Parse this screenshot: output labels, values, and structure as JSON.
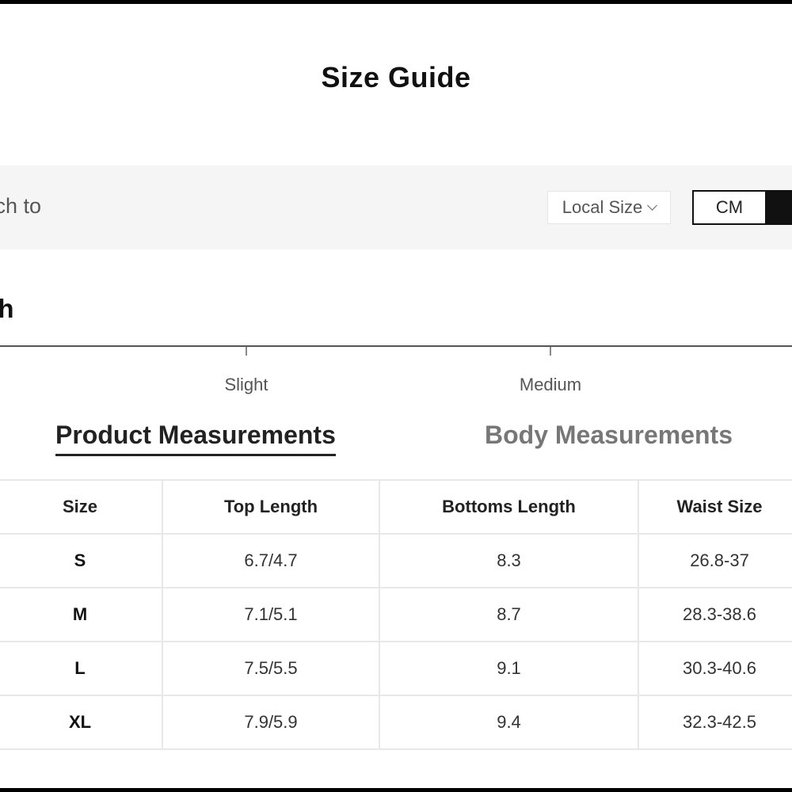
{
  "title": "Size Guide",
  "switch_bar": {
    "label": "tch to",
    "local_size": "Local Size",
    "unit_selected": "CM"
  },
  "stretch": {
    "heading": "tch",
    "levels": [
      "Slight",
      "Medium"
    ]
  },
  "tabs": [
    {
      "label": "Product Measurements",
      "active": true
    },
    {
      "label": "Body Measurements",
      "active": false
    }
  ],
  "table": {
    "headers": [
      "Size",
      "Top Length",
      "Bottoms Length",
      "Waist Size"
    ],
    "rows": [
      [
        "S",
        "6.7/4.7",
        "8.3",
        "26.8-37"
      ],
      [
        "M",
        "7.1/5.1",
        "8.7",
        "28.3-38.6"
      ],
      [
        "L",
        "7.5/5.5",
        "9.1",
        "30.3-40.6"
      ],
      [
        "XL",
        "7.9/5.9",
        "9.4",
        "32.3-42.5"
      ]
    ]
  }
}
